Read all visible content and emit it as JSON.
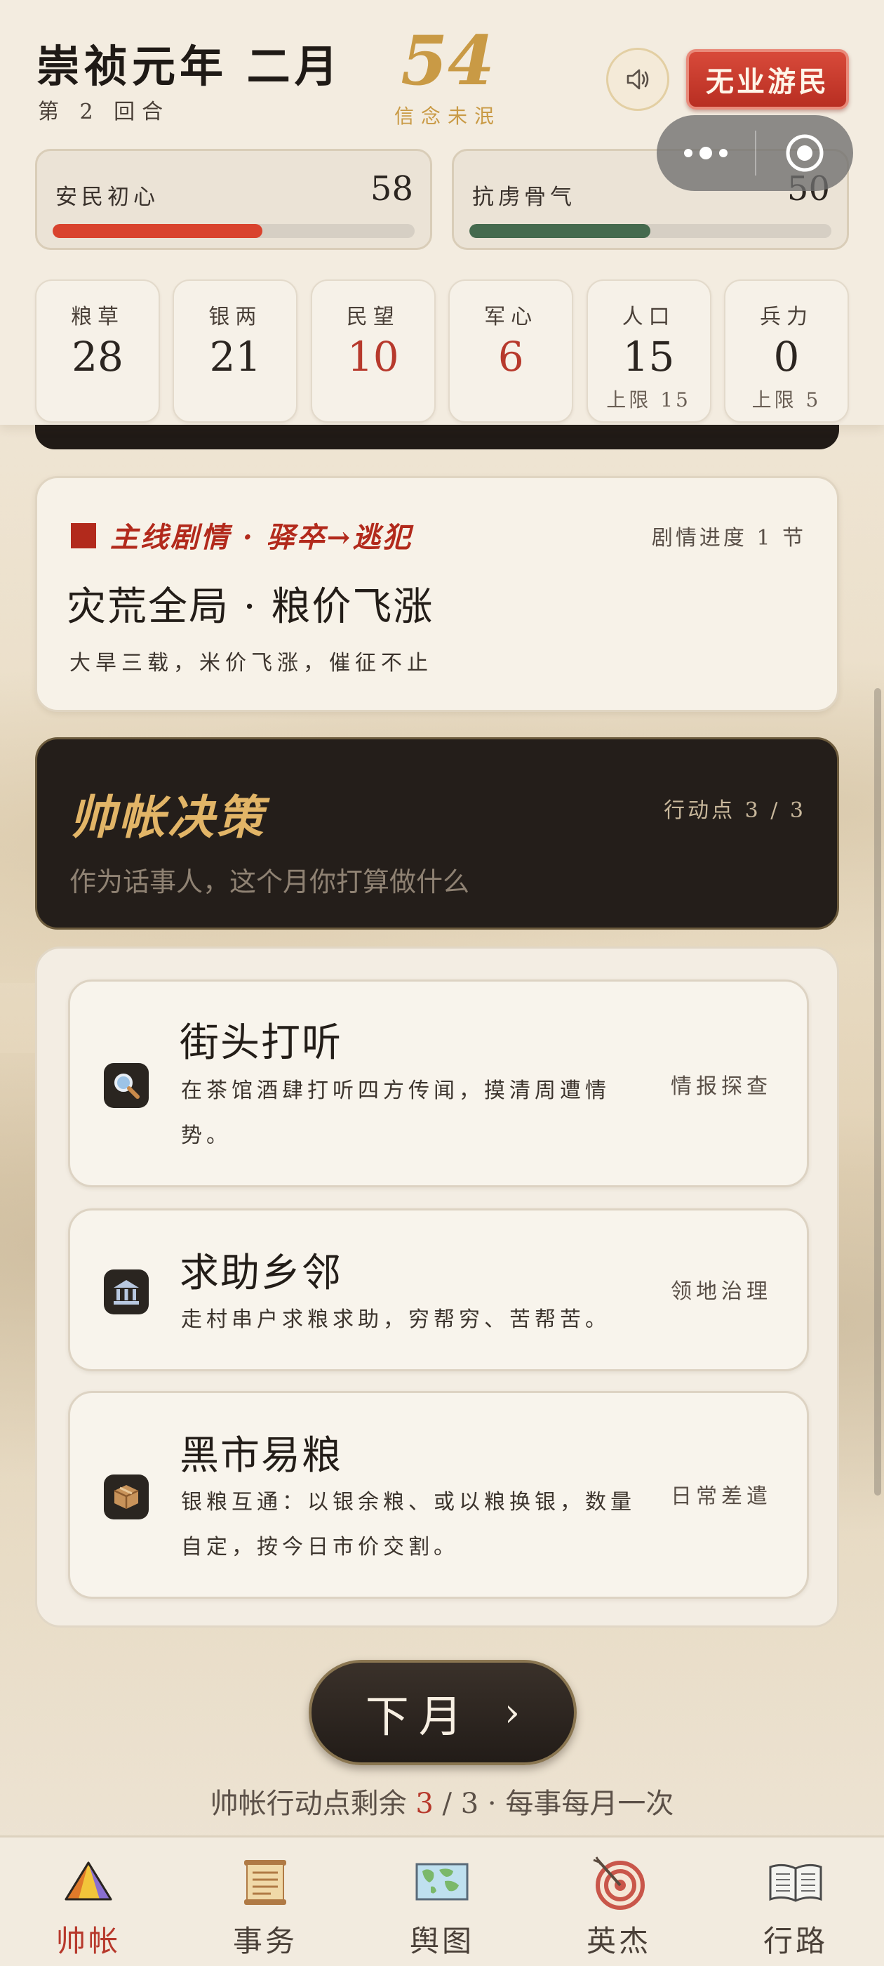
{
  "header": {
    "era": "崇祯元年 二月",
    "round": "第 2 回合",
    "faith_value": "54",
    "faith_label": "信念未泯",
    "status_tag": "无业游民"
  },
  "meters": [
    {
      "label": "安民初心",
      "value": "58",
      "percent": 58,
      "color": "#d9432e"
    },
    {
      "label": "抗虏骨气",
      "value": "50",
      "percent": 50,
      "color": "#456a4e"
    }
  ],
  "stats": [
    {
      "label": "粮草",
      "value": "28",
      "sub": "",
      "alert": false
    },
    {
      "label": "银两",
      "value": "21",
      "sub": "",
      "alert": false
    },
    {
      "label": "民望",
      "value": "10",
      "sub": "",
      "alert": true
    },
    {
      "label": "军心",
      "value": "6",
      "sub": "",
      "alert": true
    },
    {
      "label": "人口",
      "value": "15",
      "sub": "上限 15",
      "alert": false
    },
    {
      "label": "兵力",
      "value": "0",
      "sub": "上限 5",
      "alert": false
    }
  ],
  "story": {
    "title": "主线剧情 · 驿卒→逃犯",
    "progress": "剧情进度 1 节",
    "headline": "灾荒全局 · 粮价飞涨",
    "desc": "大旱三载，米价飞涨，催征不止"
  },
  "decision": {
    "title": "帅帐决策",
    "action_points": "行动点 3 / 3",
    "subtitle": "作为话事人，这个月你打算做什么"
  },
  "actions": [
    {
      "icon": "magnifier-icon",
      "name": "街头打听",
      "desc": "在茶馆酒肆打听四方传闻，摸清周遭情势。",
      "tag": "情报探查"
    },
    {
      "icon": "government-building-icon",
      "name": "求助乡邻",
      "desc": "走村串户求粮求助，穷帮穷、苦帮苦。",
      "tag": "领地治理"
    },
    {
      "icon": "package-icon",
      "name": "黑市易粮",
      "desc": "银粮互通：以银余粮、或以粮换银，数量自定，按今日市价交割。",
      "tag": "日常差遣"
    }
  ],
  "next_button": {
    "label": "下月",
    "arrow": "›"
  },
  "remaining": {
    "prefix": "帅帐行动点剩余",
    "current": "3",
    "suffix": "/ 3 · 每事每月一次"
  },
  "tabs": [
    {
      "icon": "tent-icon",
      "label": "帅帐",
      "active": true
    },
    {
      "icon": "scroll-icon",
      "label": "事务",
      "active": false
    },
    {
      "icon": "world-map-icon",
      "label": "舆图",
      "active": false
    },
    {
      "icon": "target-icon",
      "label": "英杰",
      "active": false
    },
    {
      "icon": "open-book-icon",
      "label": "行路",
      "active": false
    }
  ],
  "colors": {
    "accent_red": "#b7392c",
    "gold": "#c99a45",
    "dark": "#241e1a"
  }
}
